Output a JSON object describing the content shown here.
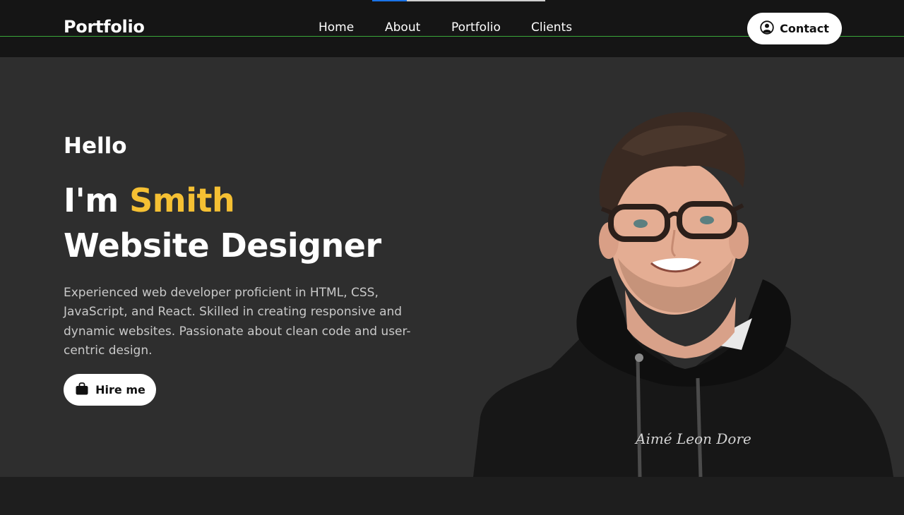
{
  "header": {
    "brand": "Portfolio",
    "nav": [
      "Home",
      "About",
      "Portfolio",
      "Clients"
    ],
    "contact_label": "Contact",
    "loading_progress": 0.2
  },
  "hero": {
    "greeting": "Hello",
    "intro_prefix": "I'm ",
    "name": "Smith",
    "role": "Website Designer",
    "description": "Experienced web developer proficient in HTML, CSS, JavaScript, and React. Skilled in creating responsive and dynamic websites. Passionate about clean code and user-centric design.",
    "hire_label": "Hire me",
    "hoodie_text": "Aimé Leon Dore"
  },
  "icons": {
    "contact": "user-circle-icon",
    "hire": "briefcase-icon"
  },
  "colors": {
    "accent": "#f5c033",
    "header_bg": "#151515",
    "hero_bg": "#2e2e2e",
    "page_bg": "#1e1e1e",
    "progress": "#1a73e8"
  }
}
